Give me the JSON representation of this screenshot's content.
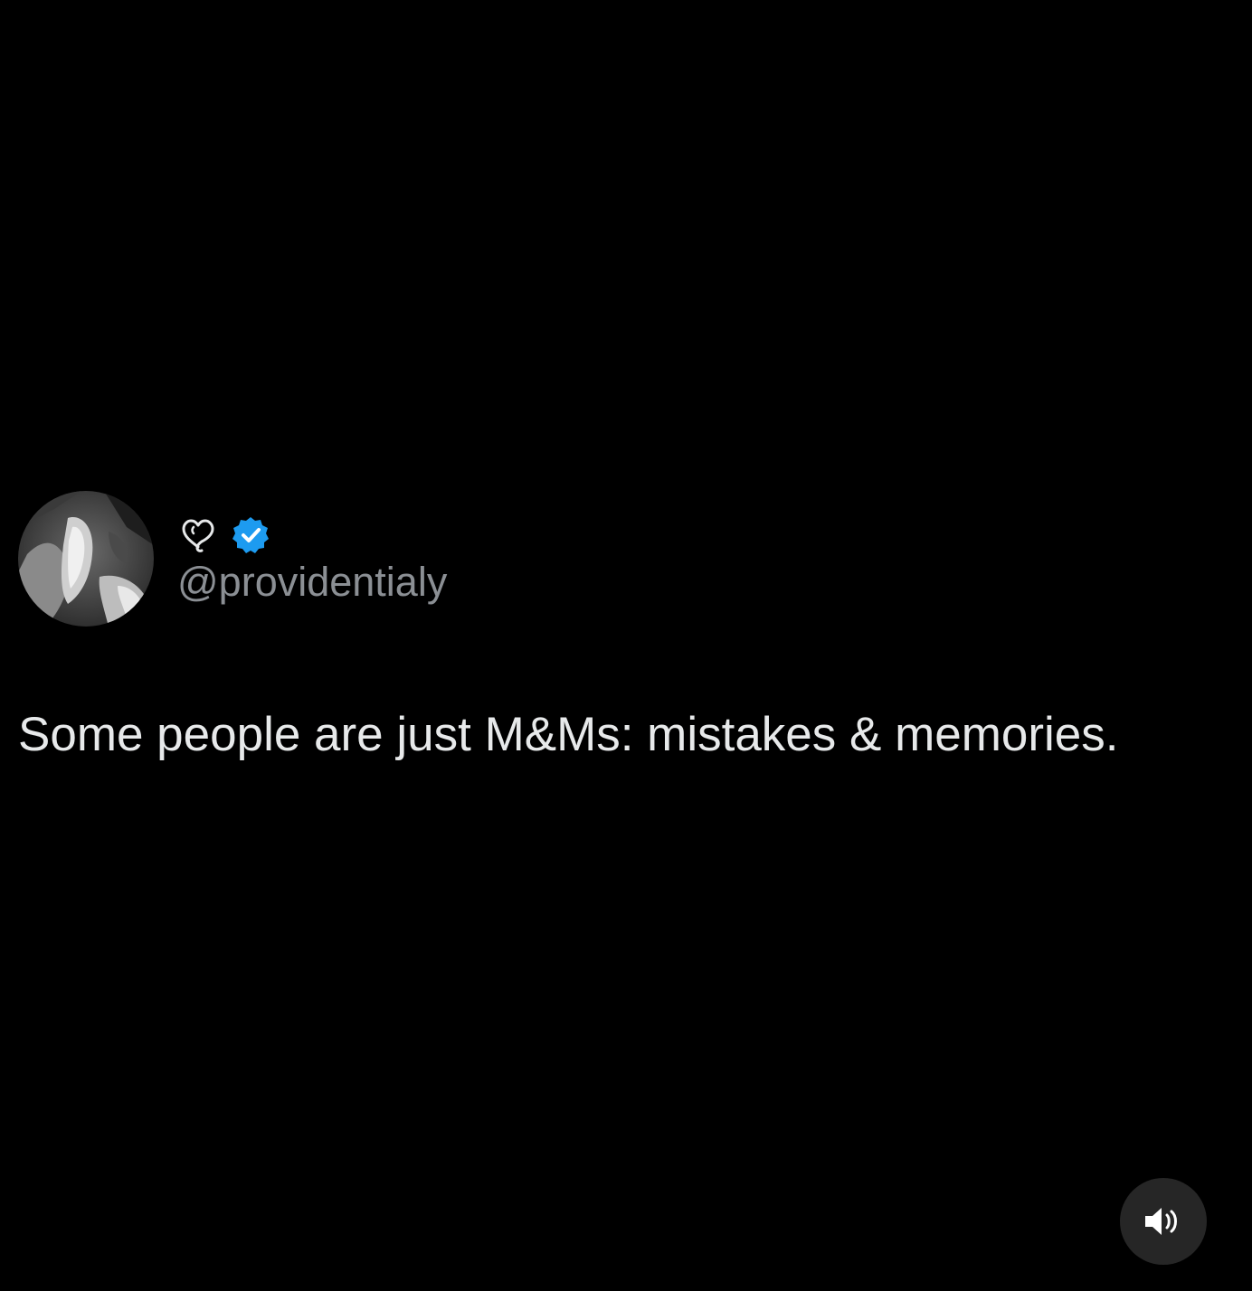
{
  "post": {
    "handle": "@providentialy",
    "text": "Some people are just M&Ms: mistakes & memories.",
    "verified": true
  },
  "icons": {
    "name_icon": "heart-outline-icon",
    "verified_icon": "verified-badge-icon",
    "sound_icon": "speaker-volume-icon"
  },
  "colors": {
    "background": "#000000",
    "text": "#e7e9ea",
    "handle": "#8b8f94",
    "verified_badge": "#1d9bf0",
    "sound_button_bg": "#262626"
  }
}
